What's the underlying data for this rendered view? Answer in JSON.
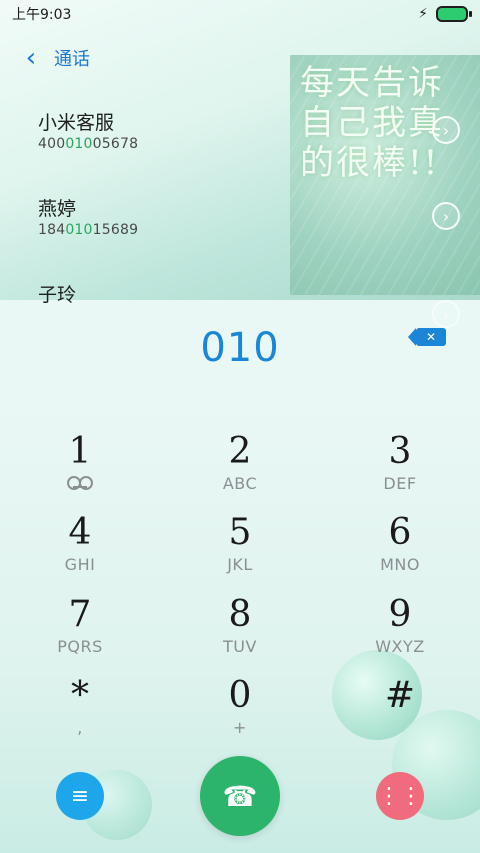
{
  "status_bar": {
    "time": "上午9:03"
  },
  "header": {
    "title": "通话"
  },
  "hero_art": {
    "caption": "每天告诉自己我真的很棒!!"
  },
  "contacts": [
    {
      "name": "小米客服",
      "number_pre": "400",
      "number_hl": "010",
      "number_post": "05678"
    },
    {
      "name": "燕婷",
      "number_pre": "184",
      "number_hl": "010",
      "number_post": "15689"
    },
    {
      "name": "子玲",
      "number_pre": "",
      "number_hl": "",
      "number_post": ""
    }
  ],
  "dial": {
    "digits": "010"
  },
  "keypad": [
    {
      "main": "1",
      "sub": ""
    },
    {
      "main": "2",
      "sub": "ABC"
    },
    {
      "main": "3",
      "sub": "DEF"
    },
    {
      "main": "4",
      "sub": "GHI"
    },
    {
      "main": "5",
      "sub": "JKL"
    },
    {
      "main": "6",
      "sub": "MNO"
    },
    {
      "main": "7",
      "sub": "PQRS"
    },
    {
      "main": "8",
      "sub": "TUV"
    },
    {
      "main": "9",
      "sub": "WXYZ"
    },
    {
      "main": "*",
      "sub": ","
    },
    {
      "main": "0",
      "sub": "+"
    },
    {
      "main": "#",
      "sub": ""
    }
  ],
  "colors": {
    "accent": "#1b86d8",
    "call_green": "#2bb46a",
    "menu_blue": "#1ea6ea",
    "pad_pink": "#f06b7b",
    "highlight_green": "#2aa65a"
  },
  "icons": {
    "back": "back-arrow-icon",
    "charging": "bolt-icon",
    "battery": "battery-icon",
    "delete": "backspace-icon",
    "menu": "menu-icon",
    "call": "phone-call-icon",
    "keypad": "keypad-icon",
    "voicemail": "voicemail-icon",
    "chevron": "chevron-right-icon"
  }
}
